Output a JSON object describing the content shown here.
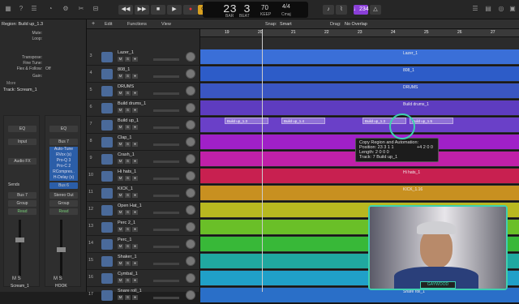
{
  "control_bar": {
    "position": "23  3",
    "bar_label": "BAR",
    "beat_label": "BEAT",
    "tempo": "70",
    "tempo_label": "KEEP",
    "signature": "4/4",
    "key": "Cmaj",
    "count_in": "♩234",
    "metronome": "1♩4"
  },
  "inspector": {
    "region_header": "Region: Build up_1.3",
    "rows": [
      {
        "label": "Mute:",
        "value": ""
      },
      {
        "label": "Loop:",
        "value": ""
      },
      {
        "label": "Transpose:",
        "value": ""
      },
      {
        "label": "Fine Tune:",
        "value": ""
      },
      {
        "label": "Flex & Follow:",
        "value": "Off"
      },
      {
        "label": "Gain:",
        "value": ""
      }
    ],
    "more": "More",
    "track_header": "Track: Scream_1",
    "left_strip": {
      "eq": "EQ",
      "input": "Input",
      "fx": "Audio FX",
      "sends": "Sends",
      "output": "Bus 7",
      "group": "Group",
      "read": "Read",
      "ms": "M   S",
      "name": "Scream_1"
    },
    "right_strip": {
      "eq": "EQ",
      "input": "Bus 7",
      "plugins": [
        "Auto-Tune",
        "RVox (s)",
        "Pro-Q 3",
        "Pro-C 2",
        "RCompres..",
        "H-Delay (s)"
      ],
      "sends": "Bus 6",
      "output": "Stereo Out",
      "group": "Group",
      "read": "Read",
      "ms": "M   S",
      "name": "HOOK"
    }
  },
  "tracks_menu": {
    "edit": "Edit",
    "functions": "Functions",
    "view": "View"
  },
  "area_menu": {
    "snap_label": "Snap:",
    "snap_value": "Smart",
    "drag_label": "Drag:",
    "drag_value": "No Overlap"
  },
  "ruler": [
    "19",
    "20",
    "21",
    "22",
    "23",
    "24",
    "25",
    "26",
    "27"
  ],
  "tracks": [
    {
      "num": "3",
      "name": "Lazer_1",
      "color": "#3a6fd8",
      "region": "Lazer_1"
    },
    {
      "num": "4",
      "name": "808_1",
      "color": "#2d5cc8",
      "region": "808_1"
    },
    {
      "num": "5",
      "name": "DRUMS",
      "color": "#3a56c2",
      "region": "DRUMS"
    },
    {
      "num": "6",
      "name": "Build drums_1",
      "color": "#5e3cc0",
      "region": "Build drums_1"
    },
    {
      "num": "7",
      "name": "Build up_1",
      "color": "#6a40c8",
      "region": ""
    },
    {
      "num": "8",
      "name": "Clap_1",
      "color": "#a020c8",
      "region": ""
    },
    {
      "num": "9",
      "name": "Crash_1",
      "color": "#c020a8",
      "region": ""
    },
    {
      "num": "10",
      "name": "Hi hats_1",
      "color": "#c82050",
      "region": "Hi hats_1"
    },
    {
      "num": "11",
      "name": "KICK_1",
      "color": "#c89020",
      "region": "KICK_1.16"
    },
    {
      "num": "12",
      "name": "Open Hat_1",
      "color": "#b8b820",
      "region": ""
    },
    {
      "num": "13",
      "name": "Perc 2_1",
      "color": "#6abf28",
      "region": ""
    },
    {
      "num": "14",
      "name": "Perc_1",
      "color": "#38b838",
      "region": ""
    },
    {
      "num": "15",
      "name": "Shaker_1",
      "color": "#20a8a0",
      "region": ""
    },
    {
      "num": "16",
      "name": "Cymbal_1",
      "color": "#20a0c8",
      "region": ""
    },
    {
      "num": "17",
      "name": "Snare roll_1",
      "color": "#2a6fc8",
      "region": "Snare roll_1"
    }
  ],
  "build_regions": [
    "Build up_1.3",
    "Build up_1.4",
    "Build up_1.3",
    "Build up_1.5"
  ],
  "tooltip": {
    "title": "Copy Region and Automation:",
    "position_label": "Position:",
    "position": "23 3 1 1",
    "offset": "+4 2 0 0",
    "length_label": "Length:",
    "length": "2 0 0 0",
    "track_label": "Track:",
    "track": "7  Build up_1"
  },
  "webcam": {
    "banner": "GAYWOOD"
  },
  "mute_solo": {
    "m": "M",
    "s": "S"
  }
}
